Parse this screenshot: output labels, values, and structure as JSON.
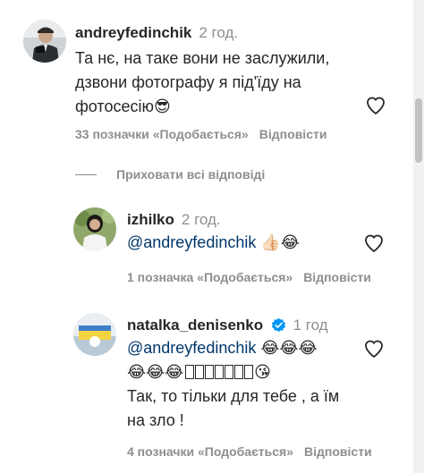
{
  "comment_main": {
    "username": "andreyfedinchik",
    "time": "2 год.",
    "line1": "Та нє, на таке вони не заслужили,",
    "line2": "дзвони фотографу я під'їду на",
    "line3": "фотосесію",
    "emoji_end": "😎",
    "likes": "33 позначки «Подобається»",
    "reply": "Відповісти"
  },
  "hide_replies": "Приховати всі відповіді",
  "reply1": {
    "username": "izhilko",
    "time": "2 год.",
    "mention": "@andreyfedinchik",
    "emojis": "👍🏻😂",
    "likes": "1 позначка «Подобається»",
    "reply": "Відповісти"
  },
  "reply2": {
    "username": "natalka_denisenko",
    "time": "1 год",
    "mention": "@andreyfedinchik",
    "emojis1": "😂😂😂",
    "emojis2": "😂😂😂",
    "emoji_end": "😘",
    "line2": "Так, то тільки для тебе , а їм",
    "line3": "на зло !",
    "likes": "4 позначки «Подобається»",
    "reply": "Відповісти"
  },
  "colors": {
    "text": "#262626",
    "muted": "#8e8e8e",
    "mention": "#00376b",
    "verified": "#0095f6"
  }
}
